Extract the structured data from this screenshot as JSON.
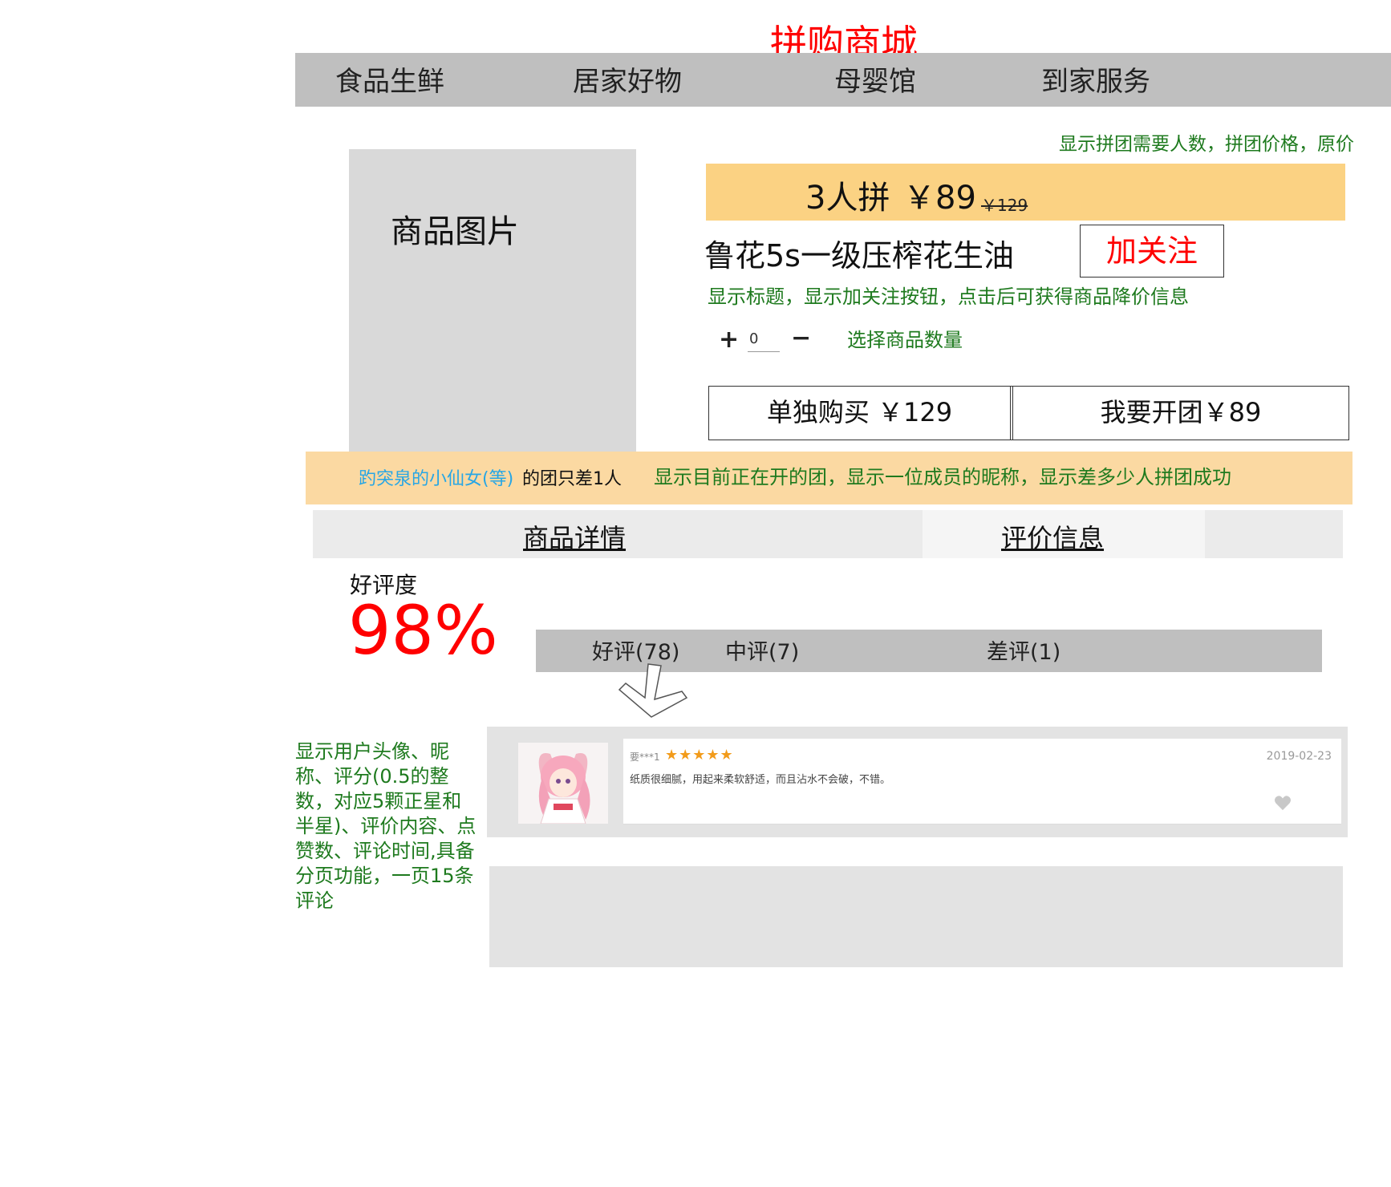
{
  "site": {
    "title": "拼购商城"
  },
  "nav": {
    "items": [
      "食品生鲜",
      "居家好物",
      "母婴馆",
      "到家服务"
    ]
  },
  "product": {
    "image_label": "商品图片",
    "group_size": "3人拼",
    "group_price": "￥89",
    "original_price": "￥129",
    "title": "鲁花5s一级压榨花生油",
    "follow_label": "加关注",
    "quantity": "0",
    "plus_symbol": "+",
    "minus_symbol": "−"
  },
  "buy": {
    "single_label": "单独购买 ￥129",
    "group_label": "我要开团￥89"
  },
  "open_group": {
    "nickname": "趵突泉的小仙女(等)",
    "suffix": "的团只差1人"
  },
  "tabs": [
    "商品详情",
    "评价信息"
  ],
  "rating": {
    "label": "好评度",
    "value": "98%"
  },
  "filters": [
    "好评(78)",
    "中评(7)",
    "差评(1)"
  ],
  "review": {
    "user": "要***1",
    "stars": "★★★★★",
    "rating": 5,
    "date": "2019-02-23",
    "content": "纸质很细腻，用起来柔软舒适，而且沾水不会破，不错。"
  },
  "notes": {
    "price": "显示拼团需要人数，拼团价格，原价",
    "title": "显示标题，显示加关注按钮，点击后可获得商品降价信息",
    "quantity": "选择商品数量",
    "open_group": "显示目前正在开的团，显示一位成员的昵称，显示差多少人拼团成功",
    "review": "显示用户头像、昵称、评分(0.5的整数，对应5颗正星和半星)、评价内容、点赞数、评论时间,具备分页功能，一页15条评论"
  },
  "colors": {
    "accent_red": "#ff0000",
    "note_green": "#1e7a1e",
    "price_bar": "#fbd283",
    "open_group_bar": "#fbd9a2",
    "nick_blue": "#27a6e5",
    "star_orange": "#f29b1a"
  },
  "icons": [
    "plus-icon",
    "minus-icon",
    "down-arrow-icon",
    "heart-icon",
    "star-icon"
  ]
}
